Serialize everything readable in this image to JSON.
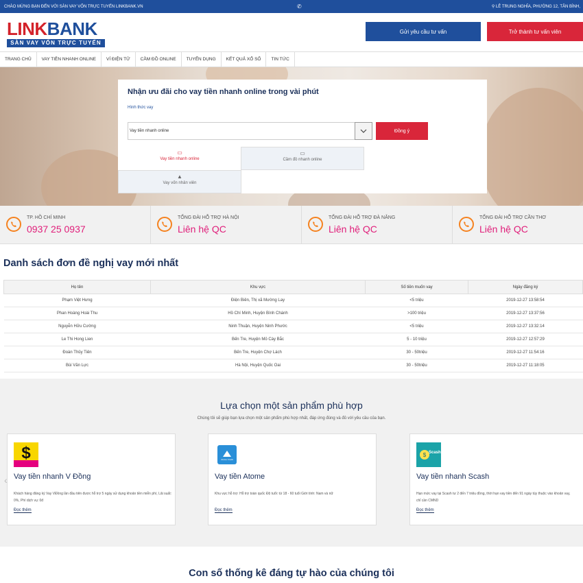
{
  "topbar": {
    "welcome": "CHÀO MỪNG BẠN ĐẾN VỚI SÀN VAY VỐN TRỰC TUYẾN LINKBANK.VN",
    "address": "LÊ TRUNG NGHĨA, PHƯỜNG 12, TÂN BÌNH,"
  },
  "header": {
    "logo_part1": "LINK",
    "logo_part2": "BANK",
    "logo_tagline": "SÀN VAY VỐN TRỰC TUYẾN",
    "consult_button": "Gửi yêu cầu tư vấn",
    "advisor_button": "Trở thành tư vấn viên"
  },
  "nav": {
    "items": [
      "TRANG CHỦ",
      "VAY TIỀN NHANH ONLINE",
      "VÍ ĐIỆN TỬ",
      "CẦM ĐỒ ONLINE",
      "TUYỂN DỤNG",
      "KẾT QUẢ XỔ SỐ",
      "TIN TỨC"
    ]
  },
  "loan_form": {
    "title": "Nhận ưu đãi cho vay tiền nhanh online trong vài phút",
    "type_label": "Hình thức vay",
    "selected": "Vay tiền nhanh online",
    "agree_button": "Đồng ý",
    "tabs": [
      "Vay tiền nhanh online",
      "Cầm đồ nhanh online",
      "Vay vốn nhân viên"
    ]
  },
  "hotlines": [
    {
      "title": "TP. HỒ CHÍ MINH",
      "number": "0937 25 0937"
    },
    {
      "title": "TỔNG ĐÀI HỖ TRỢ HÀ NỘI",
      "number": "Liên hệ QC"
    },
    {
      "title": "TỔNG ĐÀI HỖ TRỢ ĐÀ NẴNG",
      "number": "Liên hệ QC"
    },
    {
      "title": "TỔNG ĐÀI HỖ TRỢ CẦN THƠ",
      "number": "Liên hệ QC"
    }
  ],
  "loan_list": {
    "title": "Danh sách đơn đề nghị vay mới nhất",
    "columns": [
      "Họ tên",
      "Khu vực",
      "Số tiền muốn vay",
      "Ngày đăng ký"
    ],
    "rows": [
      [
        "Phạm Việt Hưng",
        "Điện Biên, Thị xã Mường Lay",
        "<5 triệu",
        "2019-12-27 13:58:54"
      ],
      [
        "Phan Hoàng Hoài Thu",
        "Hồ Chí Minh, Huyện Bình Chánh",
        ">100 triệu",
        "2019-12-27 13:37:56"
      ],
      [
        "Nguyễn Hữu Cường",
        "Ninh Thuận, Huyện Ninh Phước",
        "<5 triệu",
        "2019-12-27 13:32:14"
      ],
      [
        "Le Thi Hong Lien",
        "Bến Tre, Huyện Mỏ Cày Bắc",
        "5 - 10 triệu",
        "2019-12-27 12:57:29"
      ],
      [
        "Đoàn Thủy Tiên",
        "Bến Tre, Huyện Chợ Lách",
        "30 - 50triệu",
        "2019-12-27 11:54:16"
      ],
      [
        "Bùi Văn Lực",
        "Hà Nội, Huyện Quốc Oai",
        "30 - 50triệu",
        "2019-12-27 11:18:05"
      ]
    ]
  },
  "products": {
    "title": "Lựa chọn một sản phẩm phù hợp",
    "subtitle": "Chúng tôi sẽ giúp bạn lựa chọn một sản phẩm phù hợp nhất, đáp ứng đúng và đủ với yêu cầu của bạn.",
    "items": [
      {
        "name": "Vay tiền nhanh V Đồng",
        "desc": "Khách hàng đăng ký Vay VĐồng lần đầu tiên được hỗ trợ 5 ngày sử dụng khoản tiền miễn phí, Lãi suất: 0%, Phí dịch vụ: 0đ",
        "more": "Đọc thêm",
        "logo_text": "$"
      },
      {
        "name": "Vay tiền Atome",
        "desc": "Khu vực hỗ trợ: Hỗ trợ toàn quốc Độ tuổi: từ 18 - 60 tuổi Giới tính: Nam và nữ",
        "more": "Đọc thêm",
        "logo_text": "Atome Credit"
      },
      {
        "name": "Vay tiền nhanh Scash",
        "desc": "Hạn mức vay tại Scash tư 2 đến 7 triệu đồng, thời hạn vay tiền đến 91 ngày tùy thuộc vào khoản vay, chỉ cần CMND",
        "more": "Đọc thêm",
        "logo_text": "Scash"
      }
    ]
  },
  "stats": {
    "title": "Con số thống kê đáng tự hào của chúng tôi"
  },
  "colors": {
    "brand_blue": "#1f4f9c",
    "brand_red": "#d9263a",
    "hotline_pink": "#e01e7a",
    "phone_orange": "#f5821f"
  }
}
